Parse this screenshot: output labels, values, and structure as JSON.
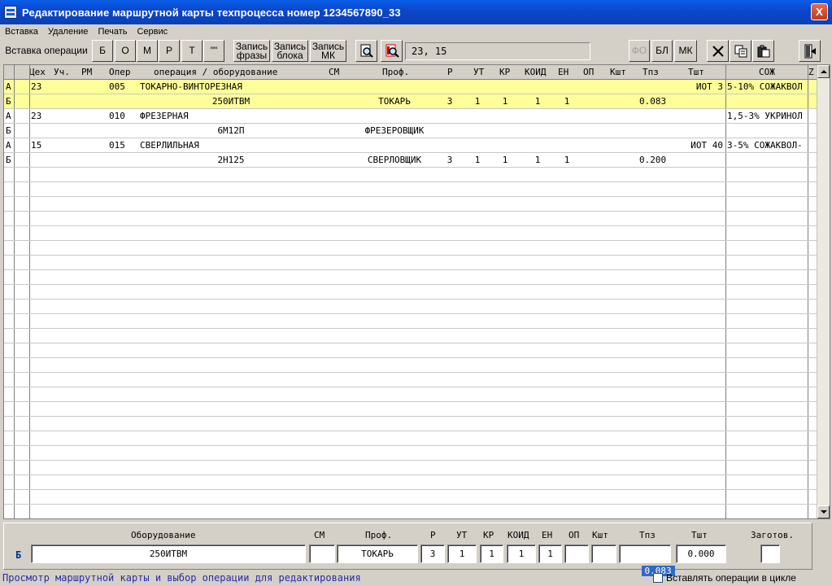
{
  "window": {
    "title": "Редактирование маршрутной карты техпроцесса номер 1234567890_33",
    "close": "X"
  },
  "menu": [
    "Вставка",
    "Удаление",
    "Печать",
    "Сервис"
  ],
  "toolbar": {
    "insert_operation": "Вставка операции",
    "letters": [
      "Б",
      "О",
      "М",
      "Р",
      "Т",
      "\"\""
    ],
    "record_phrase": "Запись\nфразы",
    "record_block": "Запись\nблока",
    "record_mk": "Запись\nМК",
    "field_value": "23, 15",
    "fo": "ФО",
    "bl": "БЛ",
    "mk": "МК"
  },
  "grid": {
    "headers": [
      "Цех",
      "Уч.",
      "РМ",
      "Опер",
      "операция / оборудование",
      "СМ",
      "Проф.",
      "Р",
      "УТ",
      "КР",
      "КОИД",
      "ЕН",
      "ОП",
      "Кшт",
      "Тпз",
      "Тшт",
      "СОЖ",
      "Z"
    ],
    "rows": [
      {
        "type": "А",
        "ceh": "23",
        "uch": "",
        "rm": "",
        "oper": "005",
        "op": "ТОКАРНО-ВИНТОРЕЗНАЯ",
        "sm": "",
        "prof": "",
        "r": "",
        "ut": "",
        "kr": "",
        "koid": "",
        "en": "",
        "opp": "",
        "ksht": "",
        "tpz": "",
        "tsht": "ИОТ 3",
        "soj": "5-10% СОЖАКВОЛ",
        "selected": true
      },
      {
        "type": "Б",
        "ceh": "",
        "uch": "",
        "rm": "",
        "oper": "",
        "op": "250ИТВМ",
        "sm": "",
        "prof": "ТОКАРЬ",
        "r": "3",
        "ut": "1",
        "kr": "1",
        "koid": "1",
        "en": "1",
        "opp": "",
        "ksht": "",
        "tpz": "0.083",
        "tsht": "",
        "soj": "",
        "selected": true
      },
      {
        "type": "А",
        "ceh": "23",
        "uch": "",
        "rm": "",
        "oper": "010",
        "op": "ФРЕЗЕРНАЯ",
        "sm": "",
        "prof": "",
        "r": "",
        "ut": "",
        "kr": "",
        "koid": "",
        "en": "",
        "opp": "",
        "ksht": "",
        "tpz": "",
        "tsht": "",
        "soj": "1,5-3% УКРИНОЛ",
        "selected": false
      },
      {
        "type": "Б",
        "ceh": "",
        "uch": "",
        "rm": "",
        "oper": "",
        "op": "6М12П",
        "sm": "",
        "prof": "ФРЕЗЕРОВЩИК",
        "r": "",
        "ut": "",
        "kr": "",
        "koid": "",
        "en": "",
        "opp": "",
        "ksht": "",
        "tpz": "",
        "tsht": "",
        "soj": "",
        "selected": false
      },
      {
        "type": "А",
        "ceh": "15",
        "uch": "",
        "rm": "",
        "oper": "015",
        "op": "СВЕРЛИЛЬНАЯ",
        "sm": "",
        "prof": "",
        "r": "",
        "ut": "",
        "kr": "",
        "koid": "",
        "en": "",
        "opp": "",
        "ksht": "",
        "tpz": "",
        "tsht": "ИОТ 40",
        "soj": "3-5% СОЖАКВОЛ-",
        "selected": false
      },
      {
        "type": "Б",
        "ceh": "",
        "uch": "",
        "rm": "",
        "oper": "",
        "op": "2Н125",
        "sm": "",
        "prof": "СВЕРЛОВЩИК",
        "r": "3",
        "ut": "1",
        "kr": "1",
        "koid": "1",
        "en": "1",
        "opp": "",
        "ksht": "",
        "tpz": "0.200",
        "tsht": "",
        "soj": "",
        "selected": false
      }
    ]
  },
  "panel": {
    "row_type": "Б",
    "labels": {
      "equipment": "Оборудование",
      "sm": "СМ",
      "prof": "Проф.",
      "r": "Р",
      "ut": "УТ",
      "kr": "КР",
      "koid": "КОИД",
      "en": "ЕН",
      "op": "ОП",
      "ksht": "Кшт",
      "tpz": "Тпз",
      "tsht": "Тшт",
      "zagotov": "Заготов."
    },
    "values": {
      "equipment": "250ИТВМ",
      "sm": "",
      "prof": "ТОКАРЬ",
      "r": "3",
      "ut": "1",
      "kr": "1",
      "koid": "1",
      "en": "1",
      "op": "",
      "ksht": "",
      "tpz": "0.083",
      "tsht": "0.000",
      "zagotov": ""
    }
  },
  "status": {
    "text": "Просмотр маршрутной карты и выбор операции для редактирования",
    "checkbox_label": "Вставлять операции в цикле"
  }
}
